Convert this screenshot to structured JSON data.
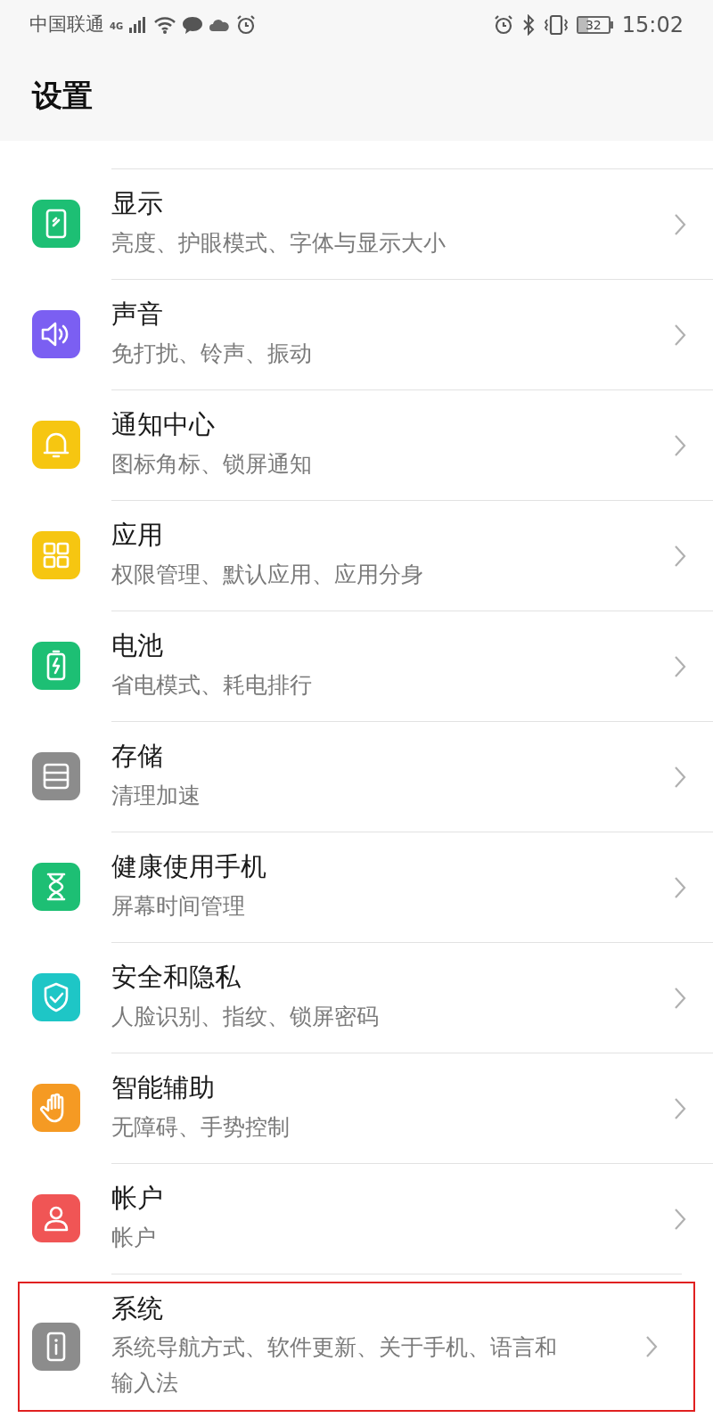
{
  "status_bar": {
    "carrier": "中国联通",
    "network": "4G",
    "battery": "32",
    "time": "15:02"
  },
  "header": {
    "title": "设置"
  },
  "items": [
    {
      "kind": "display",
      "color": "#1dbf74",
      "title": "显示",
      "subtitle": "亮度、护眼模式、字体与显示大小",
      "highlighted": false
    },
    {
      "kind": "sound",
      "color": "#7b5ff2",
      "title": "声音",
      "subtitle": "免打扰、铃声、振动",
      "highlighted": false
    },
    {
      "kind": "bell",
      "color": "#f6c611",
      "title": "通知中心",
      "subtitle": "图标角标、锁屏通知",
      "highlighted": false
    },
    {
      "kind": "apps",
      "color": "#f6c611",
      "title": "应用",
      "subtitle": "权限管理、默认应用、应用分身",
      "highlighted": false
    },
    {
      "kind": "battery",
      "color": "#1dbf74",
      "title": "电池",
      "subtitle": "省电模式、耗电排行",
      "highlighted": false
    },
    {
      "kind": "storage",
      "color": "#8c8c8c",
      "title": "存储",
      "subtitle": "清理加速",
      "highlighted": false
    },
    {
      "kind": "hourglass",
      "color": "#1dbf74",
      "title": "健康使用手机",
      "subtitle": "屏幕时间管理",
      "highlighted": false
    },
    {
      "kind": "shield",
      "color": "#1ec6c6",
      "title": "安全和隐私",
      "subtitle": "人脸识别、指纹、锁屏密码",
      "highlighted": false
    },
    {
      "kind": "hand",
      "color": "#f59a23",
      "title": "智能辅助",
      "subtitle": "无障碍、手势控制",
      "highlighted": false
    },
    {
      "kind": "person",
      "color": "#f05555",
      "title": "帐户",
      "subtitle": "帐户",
      "highlighted": false
    },
    {
      "kind": "info",
      "color": "#8c8c8c",
      "title": "系统",
      "subtitle": "系统导航方式、软件更新、关于手机、语言和输入法",
      "highlighted": true
    }
  ]
}
